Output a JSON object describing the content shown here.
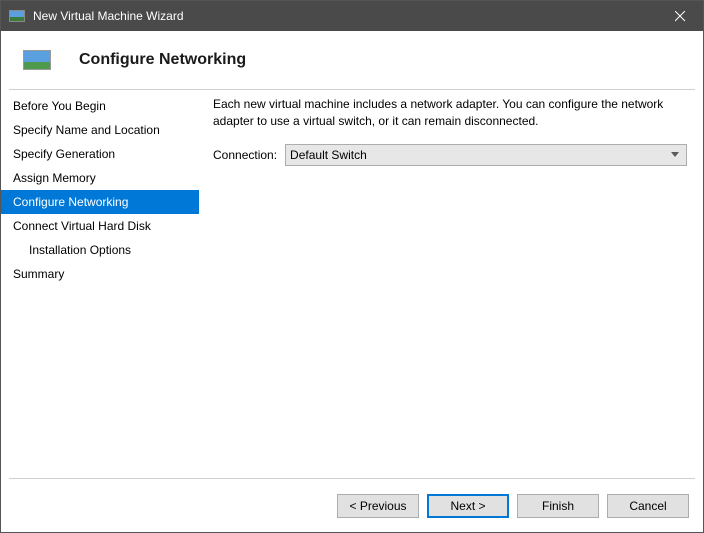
{
  "window": {
    "title": "New Virtual Machine Wizard"
  },
  "header": {
    "title": "Configure Networking"
  },
  "sidebar": {
    "items": [
      {
        "label": "Before You Begin"
      },
      {
        "label": "Specify Name and Location"
      },
      {
        "label": "Specify Generation"
      },
      {
        "label": "Assign Memory"
      },
      {
        "label": "Configure Networking"
      },
      {
        "label": "Connect Virtual Hard Disk"
      },
      {
        "label": "Installation Options"
      },
      {
        "label": "Summary"
      }
    ]
  },
  "content": {
    "description": "Each new virtual machine includes a network adapter. You can configure the network adapter to use a virtual switch, or it can remain disconnected.",
    "connection_label": "Connection:",
    "connection_value": "Default Switch"
  },
  "footer": {
    "previous": "< Previous",
    "next": "Next >",
    "finish": "Finish",
    "cancel": "Cancel"
  }
}
